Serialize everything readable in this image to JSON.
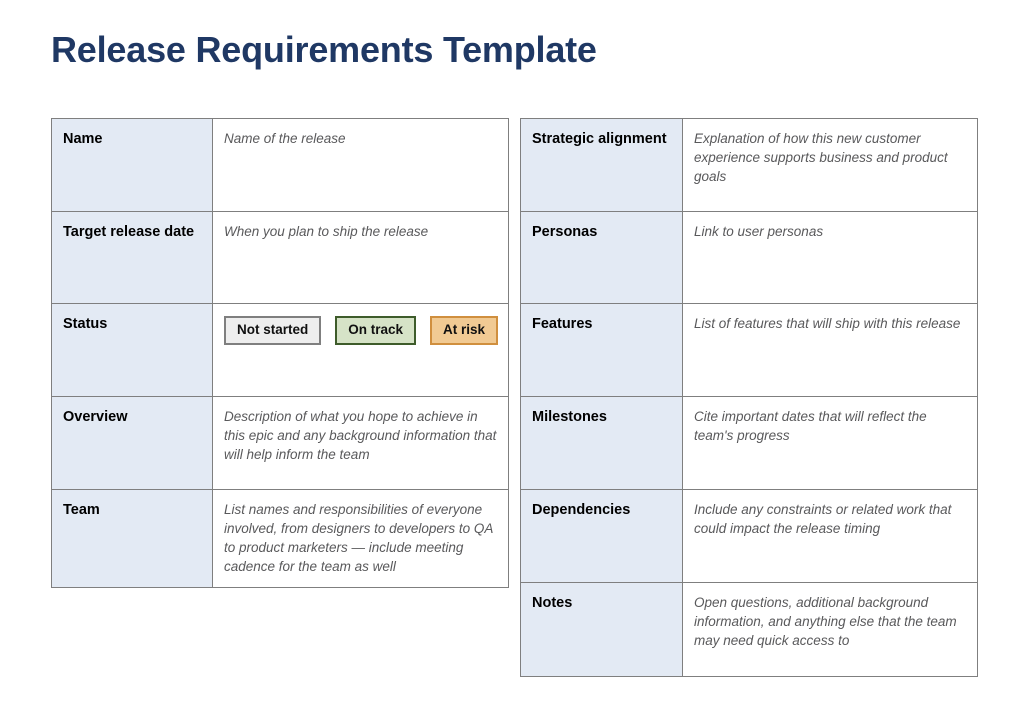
{
  "document": {
    "title": "Release Requirements Template",
    "title_color": "#1f3864"
  },
  "left_table": {
    "rows": [
      {
        "label": "Name",
        "value": "Name of the release",
        "type": "text"
      },
      {
        "label": "Target release date",
        "value": "When you plan to ship the release",
        "type": "text"
      },
      {
        "label": "Status",
        "value": "",
        "type": "badges"
      },
      {
        "label": "Overview",
        "value": "Description of what you hope to achieve in this epic and any background information that will help inform the team",
        "type": "text"
      },
      {
        "label": "Team",
        "value": "List names and responsibilities of everyone involved, from designers to developers to QA to product marketers — include meeting cadence for the team as well",
        "type": "text"
      }
    ]
  },
  "right_table": {
    "rows": [
      {
        "label": "Strategic alignment",
        "value": "Explanation of how this new customer experience supports business and product goals",
        "type": "text"
      },
      {
        "label": "Personas",
        "value": "Link to user personas",
        "type": "text"
      },
      {
        "label": "Features",
        "value": "List of features that will ship with this release",
        "type": "text"
      },
      {
        "label": "Milestones",
        "value": "Cite important dates that will reflect the team's progress",
        "type": "text"
      },
      {
        "label": "Dependencies",
        "value": "Include any constraints or related work that could impact the release timing",
        "type": "text"
      },
      {
        "label": "Notes",
        "value": "Open questions, additional background information, and anything else that the team may need quick access to",
        "type": "text"
      }
    ]
  },
  "status_badges": [
    {
      "label": "Not started",
      "fill": "#eeeeee",
      "border": "#7f7f7f"
    },
    {
      "label": "On track",
      "fill": "#d6e3c7",
      "border": "#3e5c2b"
    },
    {
      "label": "At risk",
      "fill": "#f1ca93",
      "border": "#d08f3e"
    }
  ],
  "theme": {
    "label_cell_bg": "#e3eaf4",
    "value_text_color": "#59595b",
    "border_color": "#7f7f7f",
    "page_bg": "#ffffff"
  }
}
